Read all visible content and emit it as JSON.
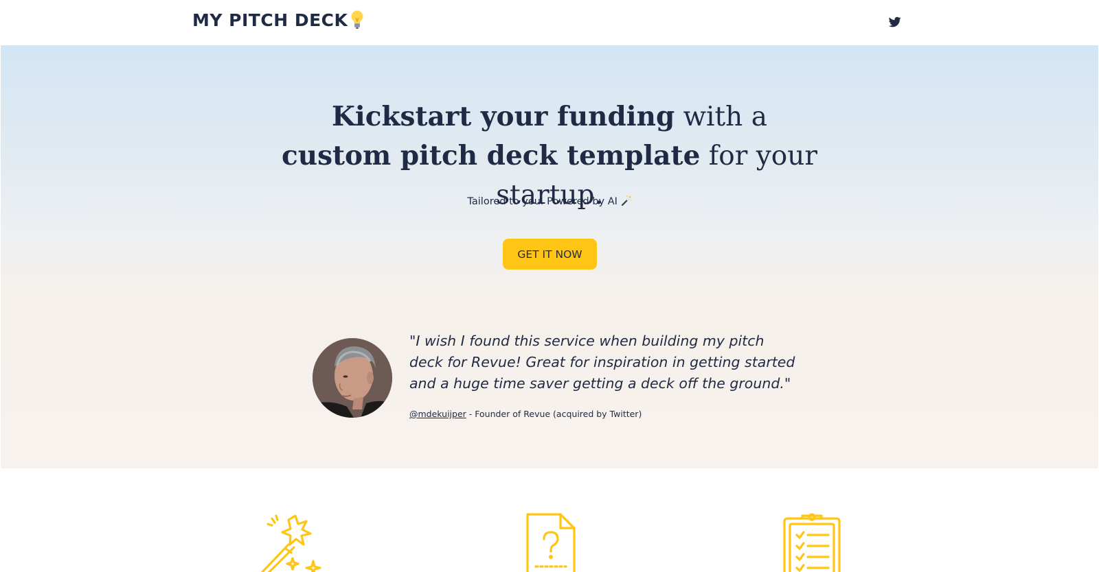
{
  "header": {
    "logo_text": "MY PITCH DECK",
    "logo_icon": "light-bulb-icon",
    "social_icon": "twitter-icon"
  },
  "hero": {
    "headline": {
      "bold_1": "Kickstart your funding",
      "regular_1": " with a ",
      "bold_2": "custom pitch deck template",
      "regular_2": " for your startup."
    },
    "tagline": "Tailored to you. Powered by AI",
    "tagline_icon": "magic-wand-icon",
    "cta_label": "GET IT NOW"
  },
  "testimonial": {
    "quote": "\"I wish I found this service when building my pitch deck for Revue! Great for inspiration in getting started and a huge time saver getting a deck off the ground.\"",
    "handle": "@mdekuijper",
    "role": " - Founder of Revue (acquired by Twitter)"
  },
  "features": {
    "icons": [
      "magic-wand-icon",
      "document-question-icon",
      "clipboard-checklist-icon"
    ]
  },
  "colors": {
    "accent": "#ffc515",
    "text": "#1f2a44",
    "hero_top": "#d3e6f4",
    "hero_bottom": "#f7f2ee"
  }
}
